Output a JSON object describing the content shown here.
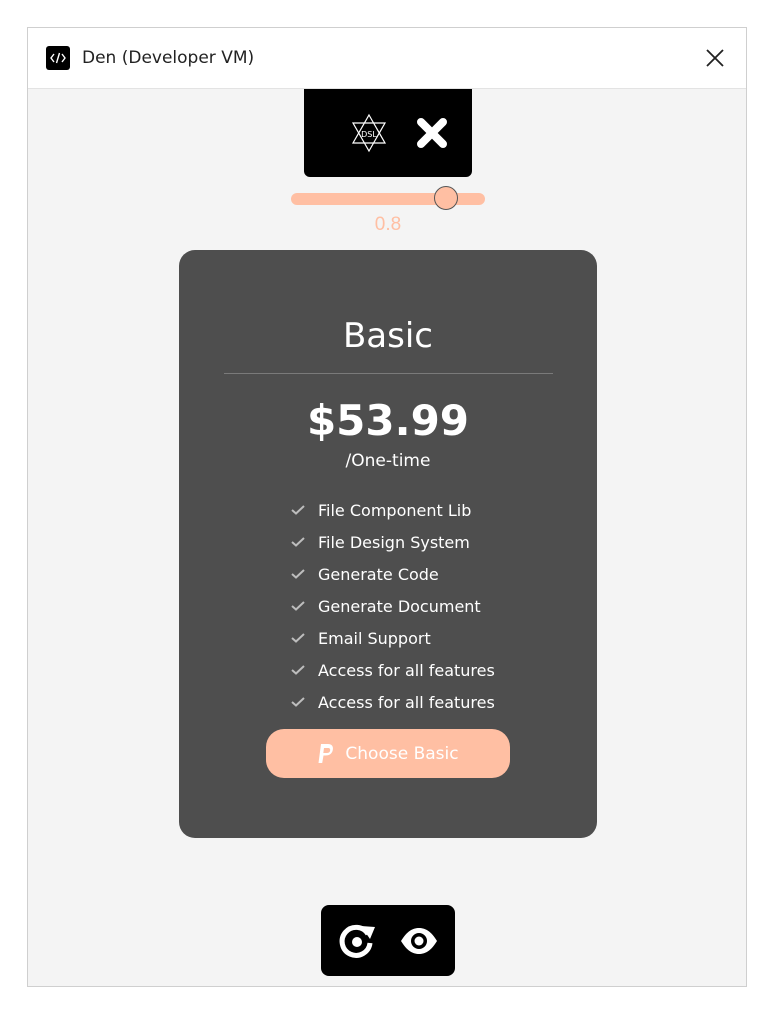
{
  "window": {
    "title": "Den (Developer VM)"
  },
  "icons": {
    "app": "code-icon",
    "close": "close-icon",
    "dsl": "dsl-star-icon",
    "remove": "x-icon",
    "refresh": "refresh-icon",
    "preview": "eye-icon",
    "check": "check-icon",
    "paypal": "paypal-icon"
  },
  "slider": {
    "value": "0.8",
    "level": 0.8
  },
  "card": {
    "plan": "Basic",
    "price": "$53.99",
    "period": "/One-time",
    "features": [
      "File Component Lib",
      "File Design System",
      "Generate Code",
      "Generate Document",
      "Email Support",
      "Access for all features",
      "Access for all features"
    ],
    "button_label": "Choose Basic"
  },
  "colors": {
    "accent": "#ffbfa3",
    "card_bg": "#4e4e4e",
    "toolbar_bg": "#000000",
    "window_bg": "#f4f4f4"
  }
}
